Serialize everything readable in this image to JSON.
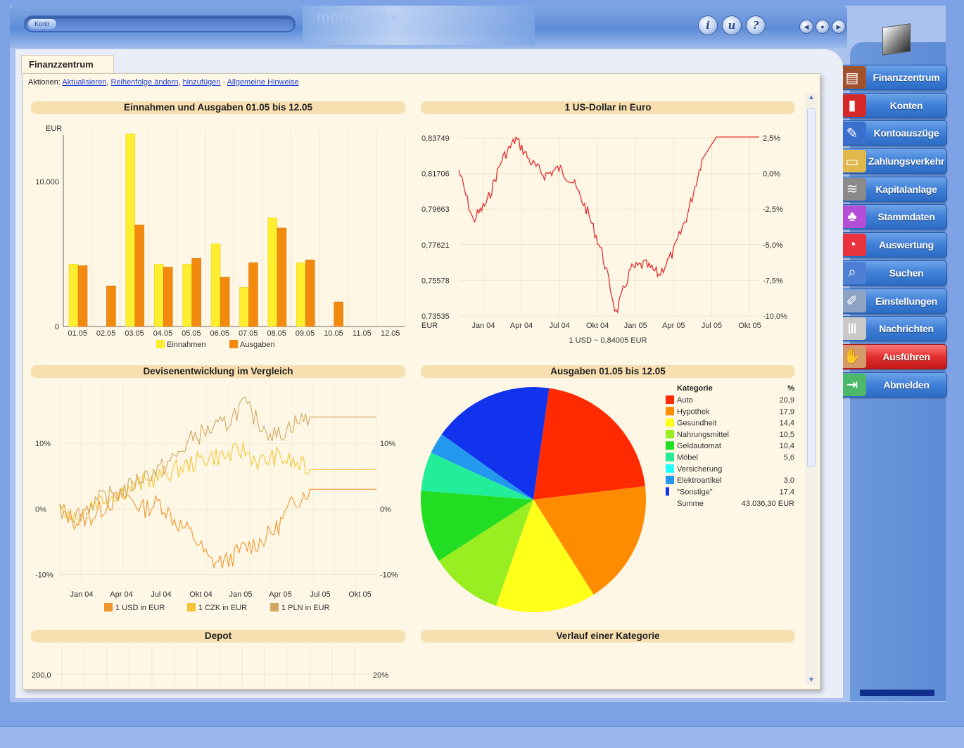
{
  "topbar": {
    "search_button": "Kontr",
    "brand": "moneyplex",
    "help_icons": [
      "info-icon",
      "user-help-icon",
      "question-icon"
    ],
    "nav_icons": [
      "back-icon",
      "home-icon",
      "forward-icon"
    ]
  },
  "tab": {
    "label": "Finanzzentrum"
  },
  "actions": {
    "prefix": "Aktionen:",
    "links": [
      "Aktualisieren",
      "Reihenfolge ändern",
      "hinzufügen",
      "Allgemeine Hinweise"
    ],
    "sep1": ",",
    "sep2": ",",
    "sep3": " · "
  },
  "sidebar": {
    "items": [
      {
        "label": "Finanzzentrum",
        "icon": "finance-center-icon",
        "color": "#a0522d"
      },
      {
        "label": "Konten",
        "icon": "accounts-icon",
        "color": "#d62828"
      },
      {
        "label": "Kontoauszüge",
        "icon": "statements-icon",
        "color": "#3a6fd0"
      },
      {
        "label": "Zahlungsverkehr",
        "icon": "payments-icon",
        "color": "#e0b84c"
      },
      {
        "label": "Kapitalanlage",
        "icon": "investment-icon",
        "color": "#8a8a8a"
      },
      {
        "label": "Stammdaten",
        "icon": "master-data-icon",
        "color": "#b34fd6"
      },
      {
        "label": "Auswertung",
        "icon": "analysis-icon",
        "color": "#e8323c"
      },
      {
        "label": "Suchen",
        "icon": "search-icon",
        "color": "#4d7fd4"
      },
      {
        "label": "Einstellungen",
        "icon": "settings-icon",
        "color": "#8ea2c4"
      },
      {
        "label": "Nachrichten",
        "icon": "messages-icon",
        "color": "#c9c9c9"
      },
      {
        "label": "Ausführen",
        "icon": "execute-icon",
        "color": "#d49a6a",
        "active": true
      },
      {
        "label": "Abmelden",
        "icon": "logout-icon",
        "color": "#4db86a"
      }
    ]
  },
  "chart_data": [
    {
      "type": "bar",
      "title": "Einnahmen und Ausgaben  01.05 bis 12.05",
      "ylabel": "EUR",
      "yticks": [
        "0",
        "10.000"
      ],
      "ylim": [
        0,
        13500
      ],
      "categories": [
        "01.05",
        "02.05",
        "03.05",
        "04.05",
        "05.05",
        "06.05",
        "07.05",
        "08.05",
        "09.05",
        "10.05",
        "11.05",
        "12.05"
      ],
      "series": [
        {
          "name": "Einnahmen",
          "color": "#ffee30",
          "values": [
            4300,
            0,
            13300,
            4300,
            4300,
            5700,
            2700,
            7500,
            4400,
            0,
            0,
            0
          ]
        },
        {
          "name": "Ausgaben",
          "color": "#f28a10",
          "values": [
            4200,
            2800,
            7000,
            4100,
            4700,
            3400,
            4400,
            6800,
            4600,
            1700,
            0,
            0
          ]
        }
      ]
    },
    {
      "type": "line",
      "title": "1 US-Dollar in Euro",
      "ylabel": "EUR",
      "yticks_left": [
        "0,83749",
        "0,81706",
        "0,79663",
        "0,77621",
        "0,75578",
        "0,73535"
      ],
      "yticks_right": [
        "2,5%",
        "0,0%",
        "-2,5%",
        "-5,0%",
        "-7,5%",
        "-10,0%"
      ],
      "xticks": [
        "Jan 04",
        "Apr 04",
        "Jul 04",
        "Okt 04",
        "Jan 05",
        "Apr 05",
        "Jul 05",
        "Okt 05"
      ],
      "footer": "1 USD ~ 0,84005 EUR",
      "series": [
        {
          "color": "#e03030",
          "x": [
            "Jan 04",
            "Feb 04",
            "Mar 04",
            "Apr 04",
            "May 04",
            "Jun 04",
            "Jul 04",
            "Aug 04",
            "Sep 04",
            "Okt 04",
            "Nov 04",
            "Dez 04",
            "Jan 05",
            "Feb 05",
            "Mar 05",
            "Apr 05",
            "May 05",
            "Jun 05",
            "Jul 05",
            "Aug 05",
            "Sep 05",
            "Okt 05"
          ],
          "values": [
            0.819,
            0.79,
            0.801,
            0.825,
            0.837,
            0.824,
            0.816,
            0.82,
            0.812,
            0.795,
            0.772,
            0.737,
            0.762,
            0.765,
            0.759,
            0.772,
            0.794,
            0.825,
            0.838,
            0.838,
            0.838,
            0.838
          ]
        }
      ]
    },
    {
      "type": "line",
      "title": "Devisenentwicklung im Vergleich",
      "yticks_left": [
        "10%",
        "0%",
        "-10%"
      ],
      "yticks_right": [
        "10%",
        "0%",
        "-10%"
      ],
      "ylim": [
        -11,
        19
      ],
      "xticks": [
        "Jan 04",
        "Apr 04",
        "Jul 04",
        "Okt 04",
        "Jan 05",
        "Apr 05",
        "Jul 05",
        "Okt 05"
      ],
      "series": [
        {
          "name": "1 USD in EUR",
          "color": "#f0952a",
          "values": [
            0,
            -2,
            -1,
            1,
            2,
            0,
            1,
            -2,
            -4,
            -8,
            -8,
            -6,
            -5,
            -3,
            1,
            3,
            3,
            3,
            3,
            3
          ]
        },
        {
          "name": "1 CZK in EUR",
          "color": "#f5c53a",
          "values": [
            0,
            -1,
            1,
            2,
            3,
            4,
            5,
            6,
            7,
            8,
            8,
            9,
            7,
            8,
            7,
            6,
            6,
            6,
            6,
            6
          ]
        },
        {
          "name": "1 PLN in EUR",
          "color": "#d0a860",
          "values": [
            0,
            -1,
            1,
            2,
            3,
            5,
            6,
            8,
            11,
            12,
            13,
            16,
            13,
            11,
            13,
            14,
            14,
            14,
            14,
            14
          ]
        }
      ]
    },
    {
      "type": "pie",
      "title": "Ausgaben  01.05 bis 12.05",
      "legend_header": [
        "Kategorie",
        "%"
      ],
      "slices": [
        {
          "name": "Auto",
          "value": 20.9,
          "color": "#ff2a00"
        },
        {
          "name": "Hypothek",
          "value": 17.9,
          "color": "#ff8c00"
        },
        {
          "name": "Gesundheit",
          "value": 14.4,
          "color": "#ffff1a"
        },
        {
          "name": "Nahrungsmittel",
          "value": 10.5,
          "color": "#99ee22"
        },
        {
          "name": "Geldautomat",
          "value": 10.4,
          "color": "#22dd22"
        },
        {
          "name": "Möbel",
          "value": 5.6,
          "color": "#22ee99"
        },
        {
          "name": "Versicherung",
          "value": 0,
          "color": "#22ffff"
        },
        {
          "name": "Elektroartikel",
          "value": 3.0,
          "color": "#2299ee"
        },
        {
          "name": "\"Sonstige\"",
          "value": 17.4,
          "color": "#1133ee"
        }
      ],
      "value_labels": [
        "20,9",
        "17,9",
        "14,4",
        "10,5",
        "10,4",
        "5,6",
        "",
        "3,0",
        "17,4"
      ],
      "total_label": "Summe",
      "total": "43.036,30 EUR"
    },
    {
      "type": "line",
      "title": "Depot",
      "yticks_left": [
        "200,0"
      ],
      "yticks_right": [
        "20%"
      ]
    },
    {
      "type": "line",
      "title": "Verlauf einer Kategorie"
    }
  ]
}
